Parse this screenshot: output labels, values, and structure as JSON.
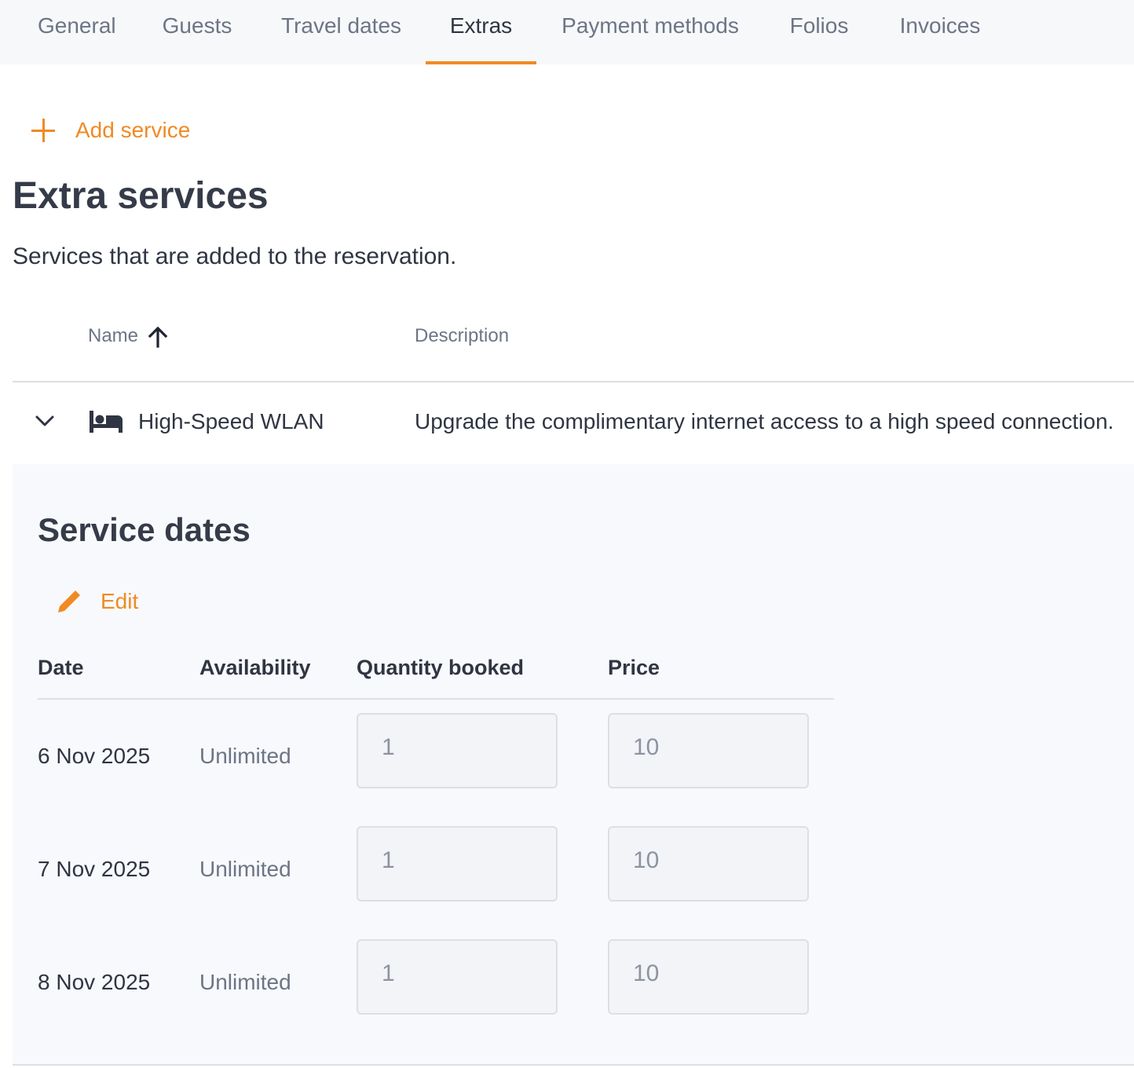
{
  "tabs": [
    {
      "label": "General"
    },
    {
      "label": "Guests"
    },
    {
      "label": "Travel dates"
    },
    {
      "label": "Extras",
      "active": true
    },
    {
      "label": "Payment methods"
    },
    {
      "label": "Folios"
    },
    {
      "label": "Invoices"
    }
  ],
  "add_service_label": "Add service",
  "page_title": "Extra services",
  "page_subtitle": "Services that are added to the reservation.",
  "table": {
    "name_header": "Name",
    "description_header": "Description",
    "sort": "ascending"
  },
  "service": {
    "icon": "bed-icon",
    "name": "High-Speed WLAN",
    "description": "Upgrade the complimentary internet access to a high speed connection.",
    "expanded": true
  },
  "service_dates": {
    "title": "Service dates",
    "edit_label": "Edit",
    "headers": {
      "date": "Date",
      "availability": "Availability",
      "quantity": "Quantity booked",
      "price": "Price"
    },
    "rows": [
      {
        "date": "6 Nov 2025",
        "availability": "Unlimited",
        "quantity": "1",
        "price": "10"
      },
      {
        "date": "7 Nov 2025",
        "availability": "Unlimited",
        "quantity": "1",
        "price": "10"
      },
      {
        "date": "8 Nov 2025",
        "availability": "Unlimited",
        "quantity": "1",
        "price": "10"
      }
    ]
  },
  "colors": {
    "accent": "#f08a24",
    "text": "#2f3542",
    "muted": "#6c7585",
    "divider": "#dcdfe4",
    "panel": "#f8f9fc"
  }
}
